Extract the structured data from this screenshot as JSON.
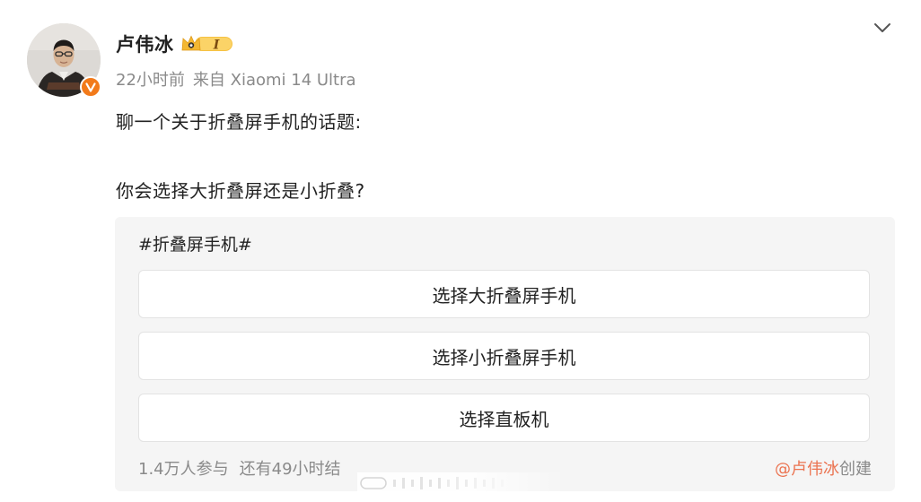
{
  "post": {
    "author": {
      "name": "卢伟冰",
      "vip_level": "I",
      "avatar": "avatar-photo",
      "verified_icon": "verified-v-icon"
    },
    "meta": {
      "time": "22小时前",
      "source": "来自 Xiaomi 14 Ultra"
    },
    "content": {
      "line1": "聊一个关于折叠屏手机的话题:",
      "line2": "你会选择大折叠屏还是小折叠?"
    },
    "poll": {
      "title": "#折叠屏手机#",
      "options": [
        {
          "label": "选择大折叠屏手机"
        },
        {
          "label": "选择小折叠屏手机"
        },
        {
          "label": "选择直板机"
        }
      ],
      "participants": "1.4万人参与",
      "remaining": "还有49小时结",
      "creator": "@卢伟冰",
      "creator_suffix": "创建"
    }
  },
  "colors": {
    "accent": "#eb7350",
    "badge_orange": "#f27a1a",
    "vip_gold": "#f3b732",
    "muted": "#8a8a8a",
    "text": "#222222",
    "poll_bg": "#f5f5f5"
  }
}
